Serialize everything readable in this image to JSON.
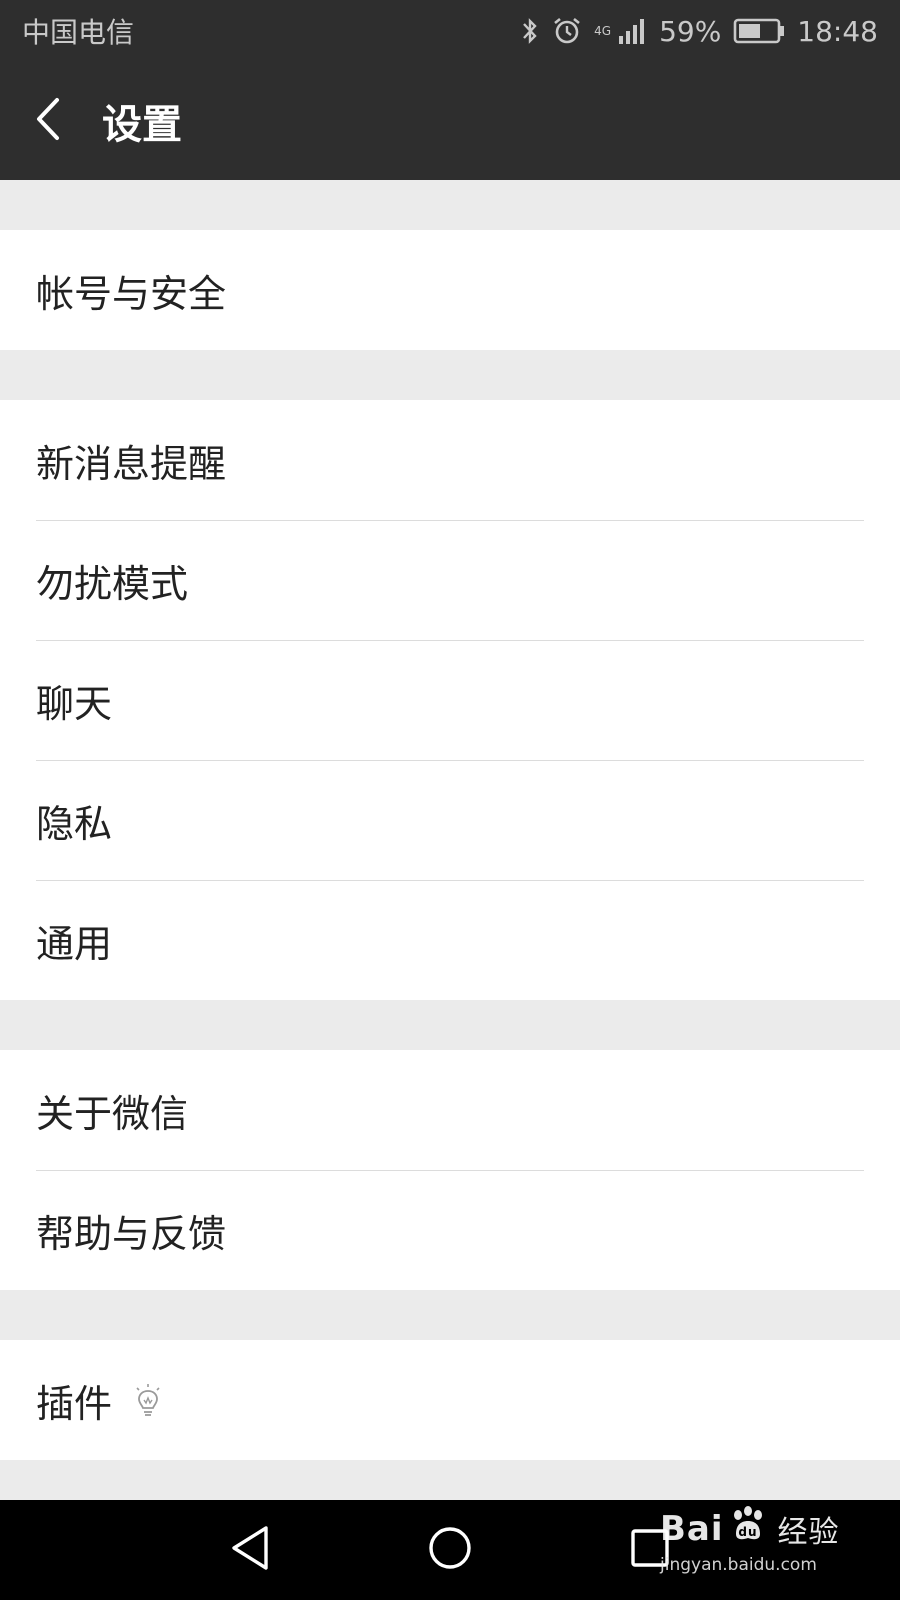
{
  "status_bar": {
    "carrier": "中国电信",
    "network": "4G",
    "battery_percent": "59%",
    "battery_level": 0.59,
    "time": "18:48",
    "icons": [
      "bluetooth-icon",
      "alarm-icon",
      "signal-icon",
      "battery-icon"
    ]
  },
  "app_bar": {
    "title": "设置",
    "back_icon": "chevron-left-icon"
  },
  "settings": {
    "groups": [
      {
        "items": [
          {
            "label": "帐号与安全"
          }
        ]
      },
      {
        "items": [
          {
            "label": "新消息提醒"
          },
          {
            "label": "勿扰模式"
          },
          {
            "label": "聊天"
          },
          {
            "label": "隐私"
          },
          {
            "label": "通用"
          }
        ]
      },
      {
        "items": [
          {
            "label": "关于微信"
          },
          {
            "label": "帮助与反馈"
          }
        ]
      },
      {
        "items": [
          {
            "label": "插件",
            "icon": "lightbulb-icon"
          }
        ]
      }
    ]
  },
  "nav_bar": {
    "icons": [
      "nav-back-icon",
      "nav-home-icon",
      "nav-recent-icon"
    ]
  },
  "watermark": {
    "brand_left": "Bai",
    "brand_right": "经验",
    "url": "jingyan.baidu.com"
  },
  "colors": {
    "bar_background": "#2e2e2e",
    "page_background": "#ebebeb",
    "row_background": "#ffffff",
    "divider": "#dcdcdc",
    "text": "#222222"
  }
}
